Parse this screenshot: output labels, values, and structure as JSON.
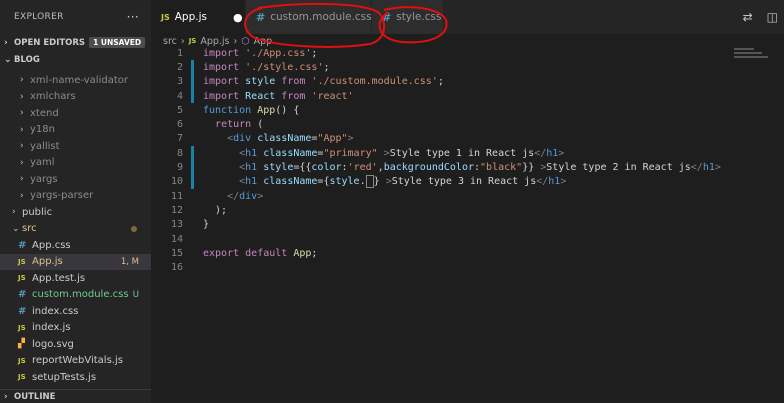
{
  "sidebar": {
    "title": "EXPLORER",
    "more_icon": "more-icon",
    "open_editors_label": "OPEN EDITORS",
    "open_editors_badge": "1 UNSAVED",
    "project_label": "BLOG",
    "tree": [
      {
        "label": "xml-name-validator",
        "kind": "folder",
        "dim": true
      },
      {
        "label": "xmlchars",
        "kind": "folder",
        "dim": true
      },
      {
        "label": "xtend",
        "kind": "folder",
        "dim": true
      },
      {
        "label": "y18n",
        "kind": "folder",
        "dim": true
      },
      {
        "label": "yallist",
        "kind": "folder",
        "dim": true
      },
      {
        "label": "yaml",
        "kind": "folder",
        "dim": true
      },
      {
        "label": "yargs",
        "kind": "folder",
        "dim": true
      },
      {
        "label": "yargs-parser",
        "kind": "folder",
        "dim": true
      },
      {
        "label": "public",
        "kind": "folder"
      },
      {
        "label": "src",
        "kind": "folder-open"
      },
      {
        "label": "App.css",
        "kind": "css"
      },
      {
        "label": "App.js",
        "kind": "js",
        "status": "1, M"
      },
      {
        "label": "App.test.js",
        "kind": "js"
      },
      {
        "label": "custom.module.css",
        "kind": "css",
        "status": "U"
      },
      {
        "label": "index.css",
        "kind": "css"
      },
      {
        "label": "index.js",
        "kind": "js"
      },
      {
        "label": "logo.svg",
        "kind": "svg"
      },
      {
        "label": "reportWebVitals.js",
        "kind": "js"
      },
      {
        "label": "setupTests.js",
        "kind": "js"
      }
    ],
    "outline_label": "OUTLINE"
  },
  "tabs": [
    {
      "label": "App.js",
      "icon": "JS",
      "modified": "●"
    },
    {
      "label": "custom.module.css",
      "icon": "#"
    },
    {
      "label": "style.css",
      "icon": "#"
    }
  ],
  "breadcrumb": {
    "folder": "src",
    "file_icon": "JS",
    "file": "App.js",
    "symbol": "App"
  },
  "code": {
    "line_numbers": [
      "1",
      "2",
      "3",
      "4",
      "5",
      "6",
      "7",
      "8",
      "9",
      "10",
      "11",
      "12",
      "13",
      "14",
      "15",
      "16"
    ]
  },
  "colors": {
    "annotation": "#e01010",
    "background": "#1e1e1e",
    "sidebar": "#252526"
  }
}
